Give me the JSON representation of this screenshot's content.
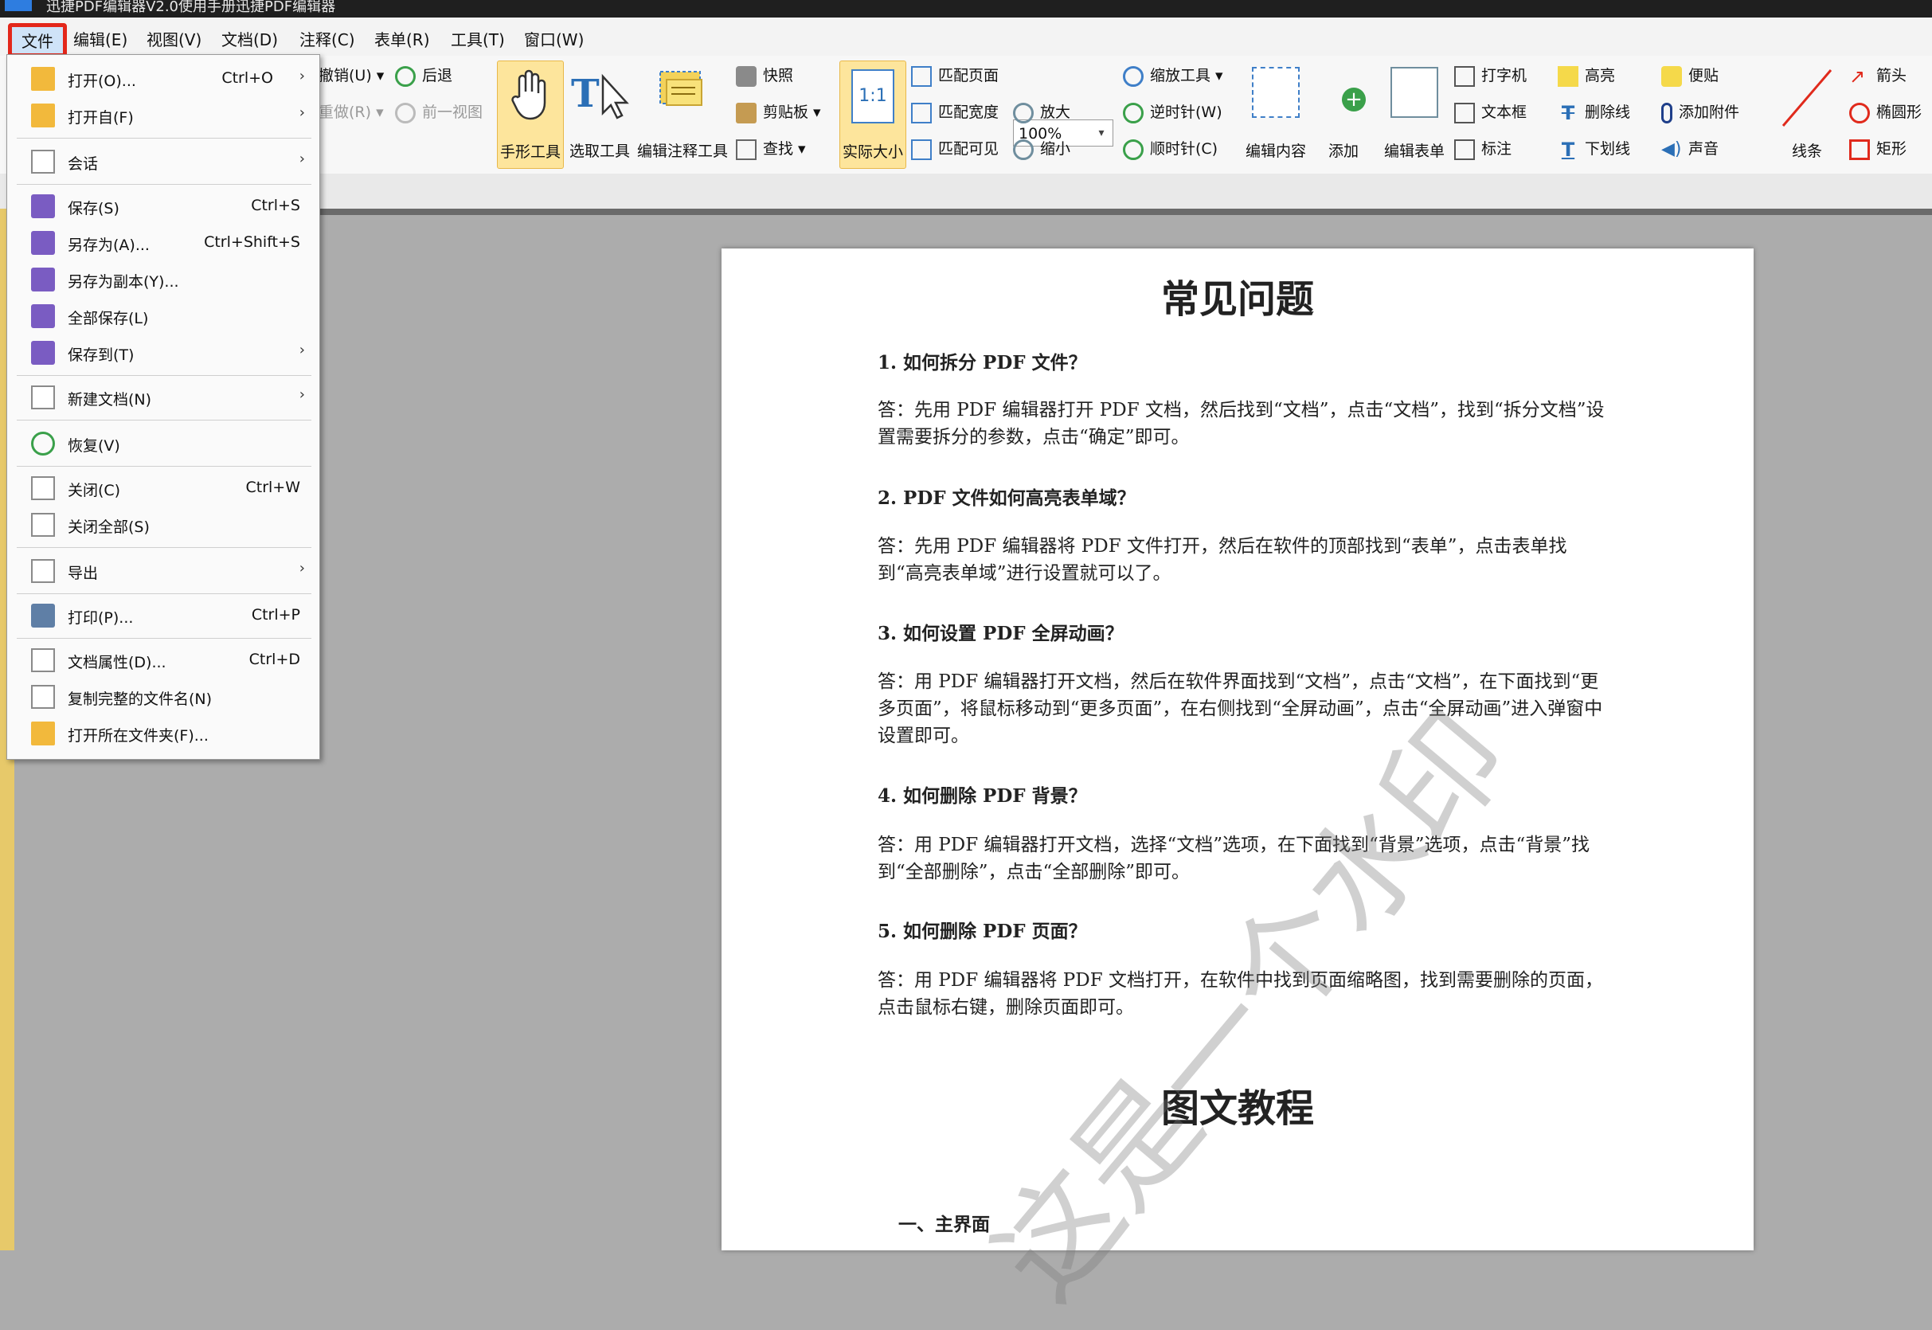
{
  "titlebar": {
    "title": "迅捷PDF编辑器V2.0使用手册迅捷PDF编辑器"
  },
  "menubar": {
    "items": [
      "文件",
      "编辑(E)",
      "视图(V)",
      "文档(D)",
      "注释(C)",
      "表单(R)",
      "工具(T)",
      "窗口(W)"
    ]
  },
  "ribbon": {
    "undo": "撤销(U)",
    "redo": "重做(R)",
    "back": "后退",
    "prev_view": "前一视图",
    "hand_tool": "手形工具",
    "select_tool": "选取工具",
    "edit_annot_tool": "编辑注释工具",
    "snapshot": "快照",
    "clipboard": "剪贴板",
    "find": "查找",
    "actual_size": "实际大小",
    "actual_size_icon_text": "1:1",
    "fit_page": "匹配页面",
    "fit_width": "匹配宽度",
    "fit_visible": "匹配可见",
    "zoom_value": "100%",
    "zoom_in": "放大",
    "zoom_out": "缩小",
    "zoom_tool": "缩放工具",
    "rotate_ccw": "逆时针(W)",
    "rotate_cw": "顺时针(C)",
    "edit_content": "编辑内容",
    "add": "添加",
    "edit_form": "编辑表单",
    "typewriter": "打字机",
    "textbox": "文本框",
    "callout": "标注",
    "highlight": "高亮",
    "strikeout": "删除线",
    "underline": "下划线",
    "note": "便贴",
    "attach": "添加附件",
    "sound": "声音",
    "line": "线条",
    "arrow": "箭头",
    "ellipse": "椭圆形",
    "rect": "矩形"
  },
  "file_menu": {
    "items": [
      {
        "label": "打开(O)...",
        "shortcut": "Ctrl+O",
        "arrow": "›"
      },
      {
        "label": "打开自(F)",
        "shortcut": "",
        "arrow": "›"
      },
      {
        "label": "会话",
        "shortcut": "",
        "arrow": "›"
      },
      {
        "label": "保存(S)",
        "shortcut": "Ctrl+S",
        "arrow": ""
      },
      {
        "label": "另存为(A)...",
        "shortcut": "Ctrl+Shift+S",
        "arrow": ""
      },
      {
        "label": "另存为副本(Y)...",
        "shortcut": "",
        "arrow": ""
      },
      {
        "label": "全部保存(L)",
        "shortcut": "",
        "arrow": ""
      },
      {
        "label": "保存到(T)",
        "shortcut": "",
        "arrow": "›"
      },
      {
        "label": "新建文档(N)",
        "shortcut": "",
        "arrow": "›"
      },
      {
        "label": "恢复(V)",
        "shortcut": "",
        "arrow": ""
      },
      {
        "label": "关闭(C)",
        "shortcut": "Ctrl+W",
        "arrow": ""
      },
      {
        "label": "关闭全部(S)",
        "shortcut": "",
        "arrow": ""
      },
      {
        "label": "导出",
        "shortcut": "",
        "arrow": "›"
      },
      {
        "label": "打印(P)...",
        "shortcut": "Ctrl+P",
        "arrow": ""
      },
      {
        "label": "文档属性(D)...",
        "shortcut": "Ctrl+D",
        "arrow": ""
      },
      {
        "label": "复制完整的文件名(N)",
        "shortcut": "",
        "arrow": ""
      },
      {
        "label": "打开所在文件夹(F)...",
        "shortcut": "",
        "arrow": ""
      }
    ]
  },
  "document": {
    "title": "常见问题",
    "qa": [
      {
        "q": "1.  如何拆分 PDF 文件？",
        "a": "答：先用 PDF 编辑器打开 PDF 文档，然后找到“文档”，点击“文档”，找到“拆分文档”设置需要拆分的参数，点击“确定”即可。"
      },
      {
        "q": "2.  PDF 文件如何高亮表单域？",
        "a": "答：先用 PDF 编辑器将 PDF 文件打开，然后在软件的顶部找到“表单”，点击表单找到“高亮表单域”进行设置就可以了。"
      },
      {
        "q": "3.  如何设置 PDF 全屏动画？",
        "a": "答：用 PDF 编辑器打开文档，然后在软件界面找到“文档”，点击“文档”，在下面找到“更多页面”，将鼠标移动到“更多页面”，在右侧找到“全屏动画”，点击“全屏动画”进入弹窗中设置即可。"
      },
      {
        "q": "4.  如何删除 PDF 背景？",
        "a": "答：用 PDF 编辑器打开文档，选择“文档”选项，在下面找到“背景”选项，点击“背景”找到“全部删除”，点击“全部删除”即可。"
      },
      {
        "q": "5.  如何删除 PDF 页面？",
        "a": "答：用 PDF 编辑器将 PDF 文档打开，在软件中找到页面缩略图，找到需要删除的页面，点击鼠标右键，删除页面即可。"
      }
    ],
    "section_title": "图文教程",
    "subsection": "一、主界面",
    "watermark": "这是一个水印"
  },
  "colors": {
    "accent_red": "#e3271b",
    "active_tool": "#fde59c"
  }
}
